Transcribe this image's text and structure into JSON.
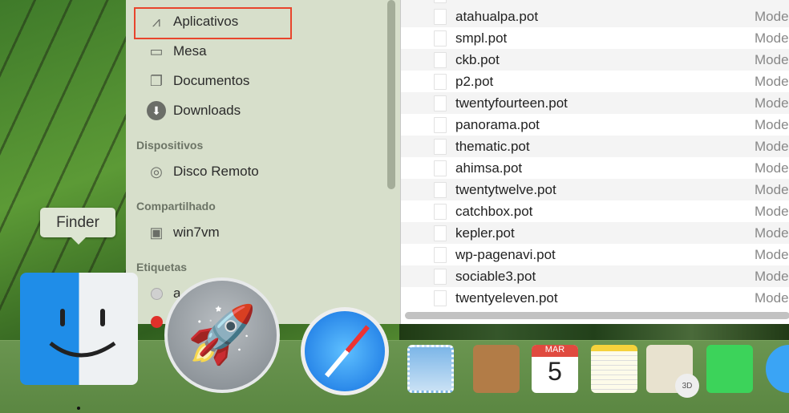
{
  "sidebar": {
    "favorites": [
      {
        "label": "Aplicativos",
        "icon": "applications-icon",
        "highlighted": true
      },
      {
        "label": "Mesa",
        "icon": "desktop-icon"
      },
      {
        "label": "Documentos",
        "icon": "documents-icon"
      },
      {
        "label": "Downloads",
        "icon": "downloads-icon"
      }
    ],
    "devices_header": "Dispositivos",
    "devices": [
      {
        "label": "Disco Remoto",
        "icon": "disc-icon"
      }
    ],
    "shared_header": "Compartilhado",
    "shared": [
      {
        "label": "win7vm",
        "icon": "monitor-icon"
      }
    ],
    "tags_header": "Etiquetas",
    "tags": [
      {
        "label": "a",
        "color": "#d0d0d0"
      },
      {
        "label": "",
        "color": "#e0302a"
      }
    ]
  },
  "files": [
    {
      "name": "atahualpa.pot",
      "kind": "Mode"
    },
    {
      "name": "smpl.pot",
      "kind": "Mode"
    },
    {
      "name": "ckb.pot",
      "kind": "Mode"
    },
    {
      "name": "p2.pot",
      "kind": "Mode"
    },
    {
      "name": "twentyfourteen.pot",
      "kind": "Mode"
    },
    {
      "name": "panorama.pot",
      "kind": "Mode"
    },
    {
      "name": "thematic.pot",
      "kind": "Mode"
    },
    {
      "name": "ahimsa.pot",
      "kind": "Mode"
    },
    {
      "name": "twentytwelve.pot",
      "kind": "Mode"
    },
    {
      "name": "catchbox.pot",
      "kind": "Mode"
    },
    {
      "name": "kepler.pot",
      "kind": "Mode"
    },
    {
      "name": "wp-pagenavi.pot",
      "kind": "Mode"
    },
    {
      "name": "sociable3.pot",
      "kind": "Mode"
    },
    {
      "name": "twentyeleven.pot",
      "kind": "Mode"
    }
  ],
  "dock": {
    "tooltip": "Finder",
    "calendar_month": "MAR",
    "calendar_day": "5",
    "maps_badge": "3D",
    "apps": [
      "Finder",
      "Launchpad",
      "Safari",
      "Mail",
      "Contacts",
      "Calendar",
      "Notes",
      "Maps",
      "FaceTime",
      "Messages"
    ]
  },
  "colors": {
    "highlight": "#e8452c",
    "sidebar": "#d7dfcb",
    "dock": "#5f8a46"
  }
}
